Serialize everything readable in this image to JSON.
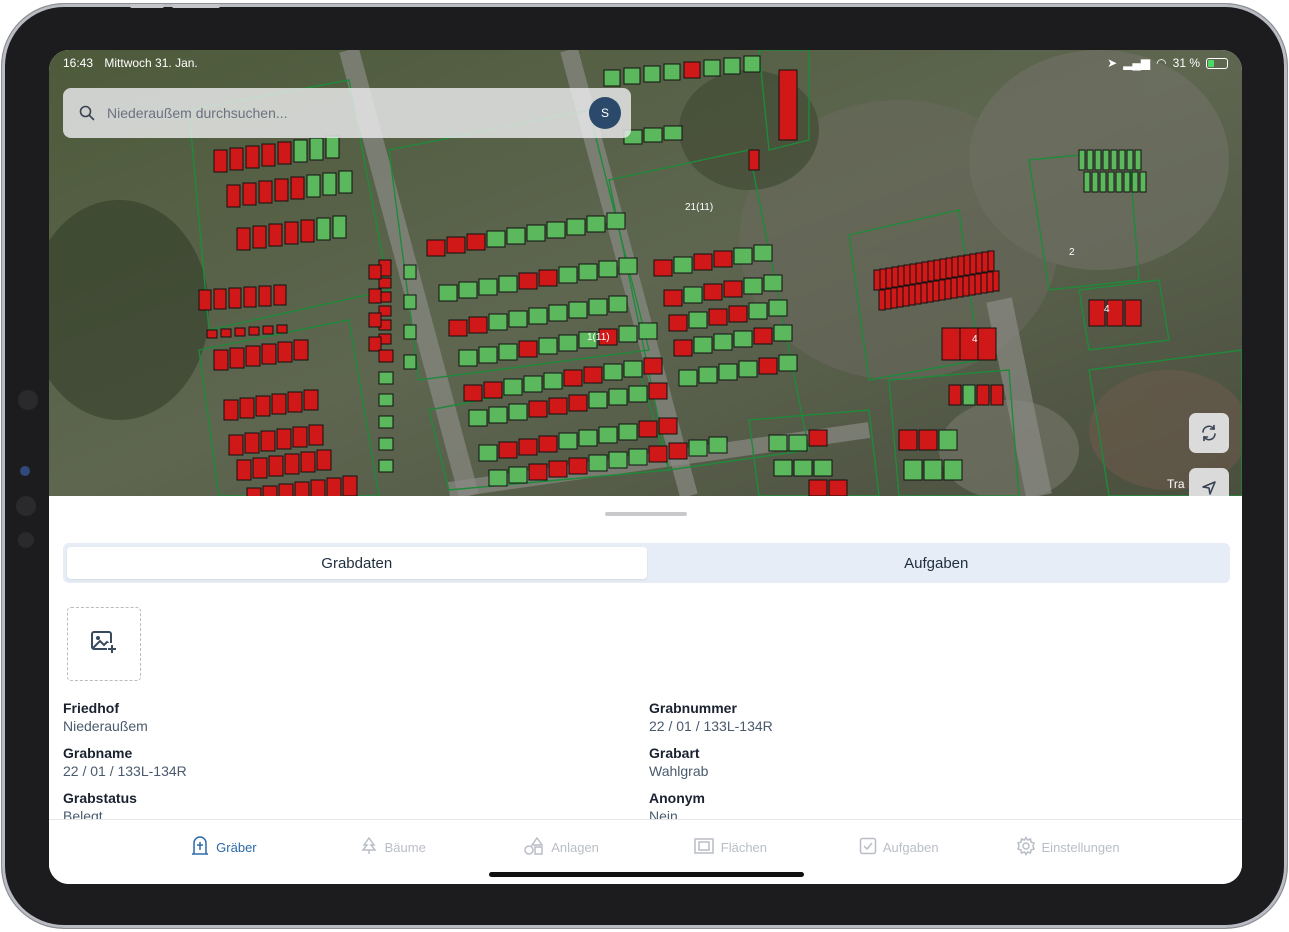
{
  "status_bar": {
    "time": "16:43",
    "date": "Mittwoch 31. Jan.",
    "battery": "31 %"
  },
  "search": {
    "placeholder": "Niederaußem durchsuchen...",
    "avatar_initial": "S"
  },
  "map": {
    "labels": [
      "21(11)",
      "1(11)",
      "4",
      "2",
      "4",
      "Tra"
    ]
  },
  "tabs": {
    "grabdaten": "Grabdaten",
    "aufgaben": "Aufgaben"
  },
  "details": {
    "friedhof_label": "Friedhof",
    "friedhof_value": "Niederaußem",
    "grabnummer_label": "Grabnummer",
    "grabnummer_value": "22 / 01 / 133L-134R",
    "grabname_label": "Grabname",
    "grabname_value": "22 / 01 / 133L-134R",
    "grabart_label": "Grabart",
    "grabart_value": "Wahlgrab",
    "grabstatus_label": "Grabstatus",
    "grabstatus_value": "Belegt",
    "anonym_label": "Anonym",
    "anonym_value": "Nein"
  },
  "nav": {
    "graeber": "Gräber",
    "baeume": "Bäume",
    "anlagen": "Anlagen",
    "flaechen": "Flächen",
    "aufgaben": "Aufgaben",
    "einstellungen": "Einstellungen"
  },
  "colors": {
    "occupied": "#d01818",
    "free": "#5cb85c",
    "accent": "#2b6aa8"
  }
}
